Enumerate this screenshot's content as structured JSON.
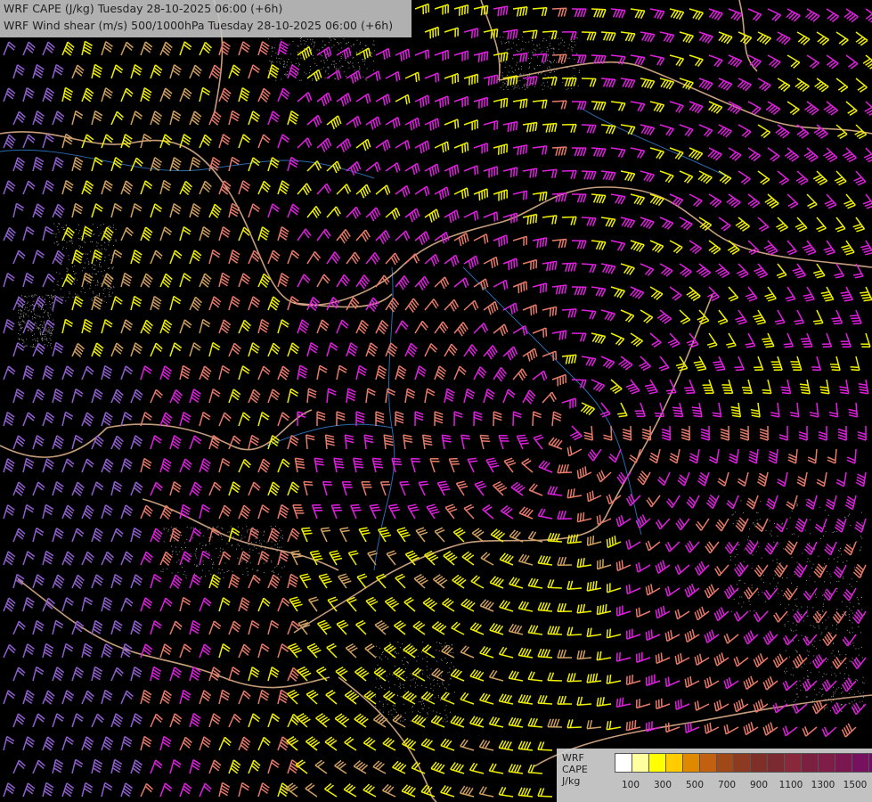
{
  "header": {
    "title_line_1": "WRF CAPE (J/kg) Tuesday 28-10-2025 06:00 (+6h)",
    "title_line_2": "WRF Wind shear (m/s) 500/1000hPa Tuesday 28-10-2025 06:00 (+6h)"
  },
  "legend": {
    "label_1": "WRF",
    "label_2": "CAPE",
    "label_3": "J/kg",
    "swatch_colors": [
      "#ffffff",
      "#ffffa0",
      "#ffff00",
      "#ffcc00",
      "#e08800",
      "#c06010",
      "#a04818",
      "#8c3a20",
      "#802e28",
      "#7a2a30",
      "#88283a",
      "#7c2040",
      "#801c48",
      "#7a1650",
      "#781060",
      "#700a68"
    ],
    "ticks": [
      "100",
      "300",
      "500",
      "700",
      "900",
      "1100",
      "1300",
      "1500"
    ]
  },
  "colors": {
    "background": "#000000",
    "border_country": "#e8b890",
    "river": "#2a6ab0",
    "barb_magenta": "#e020e0",
    "barb_salmon": "#e87a6a",
    "barb_yellow": "#f0f000",
    "barb_tan": "#d0a060",
    "barb_purple": "#9060d0",
    "stipple": "#909090"
  }
}
